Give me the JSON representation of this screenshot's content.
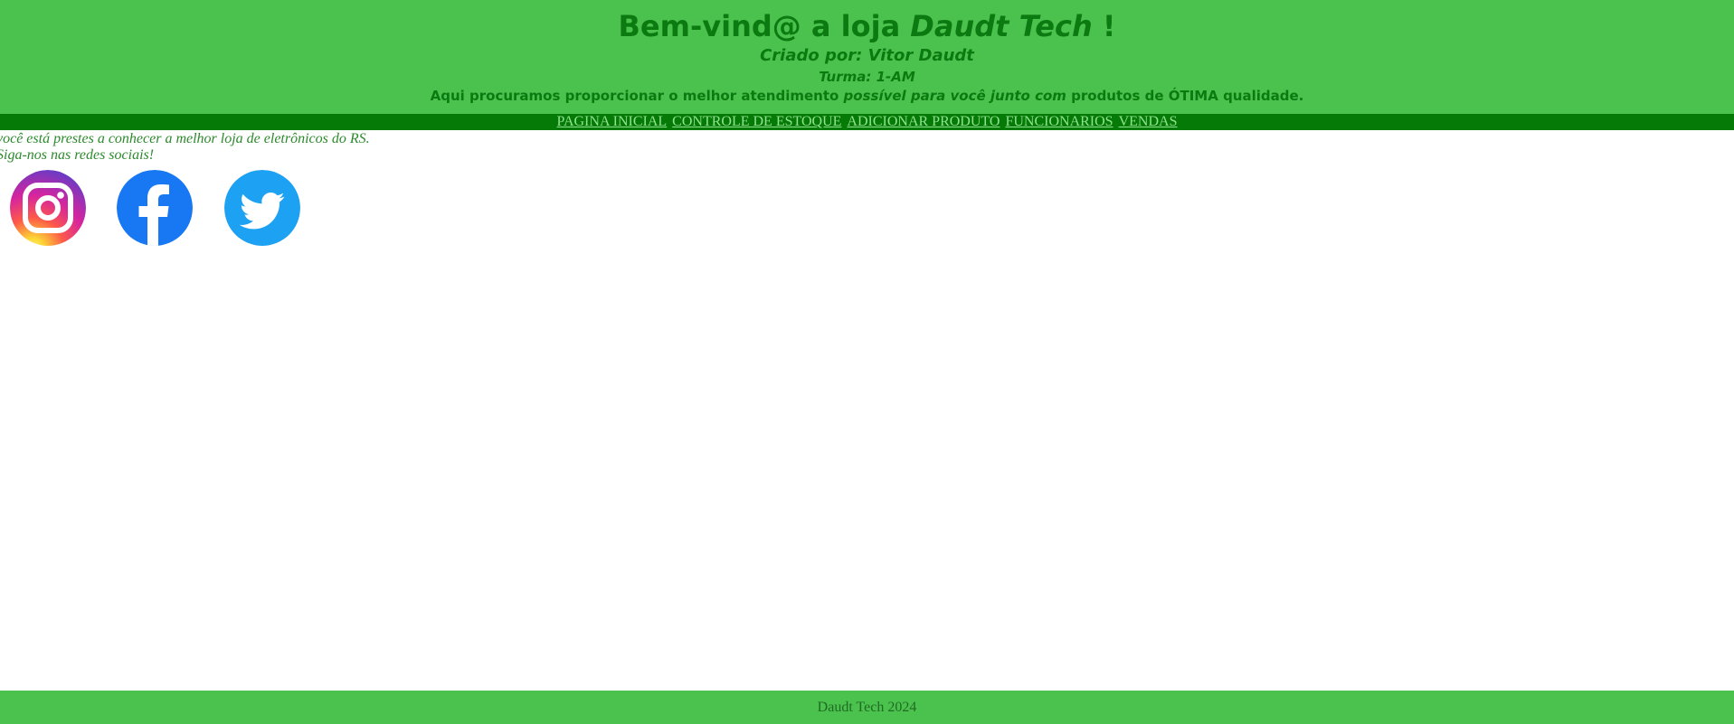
{
  "header": {
    "title_prefix": "Bem-vind@ a loja ",
    "title_brand": "Daudt Tech",
    "title_suffix": " !",
    "creator": "Criado por: Vitor Daudt",
    "turma": "Turma: 1-AM",
    "tagline_part1": "Aqui procuramos proporcionar o melhor atendimento ",
    "tagline_italic": "possível para você junto com",
    "tagline_part2": " produtos de ÓTIMA qualidade."
  },
  "nav": {
    "items": [
      {
        "label": "PAGINA INICIAL"
      },
      {
        "label": "CONTROLE DE ESTOQUE"
      },
      {
        "label": "ADICIONAR PRODUTO"
      },
      {
        "label": "FUNCIONARIOS"
      },
      {
        "label": "VENDAS"
      }
    ]
  },
  "intro": {
    "line1": "você está prestes a conhecer a melhor loja de eletrônicos do RS.",
    "line2": "Siga-nos nas redes sociais!"
  },
  "social": [
    {
      "icon": "instagram-icon",
      "color": "#d6249f"
    },
    {
      "icon": "facebook-icon",
      "color": "#1877f2"
    },
    {
      "icon": "twitter-icon",
      "color": "#1da1f2"
    }
  ],
  "footer": {
    "text": "Daudt Tech 2024"
  },
  "colors": {
    "header_bg": "#4bc24e",
    "nav_bg": "#067a06",
    "text_green": "#0b7a10",
    "nav_link": "#8fe28f"
  }
}
